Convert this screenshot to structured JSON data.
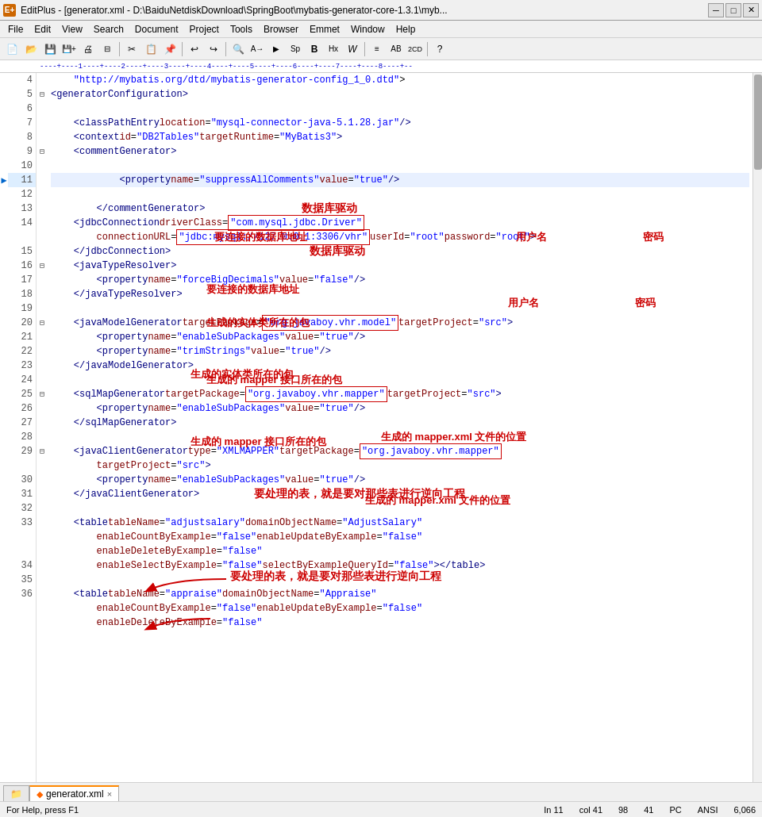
{
  "titlebar": {
    "title": "EditPlus - [generator.xml - D:\\BaiduNetdiskDownload\\SpringBoot\\mybatis-generator-core-1.3.1\\myb...",
    "app_name": "EditPlus"
  },
  "menu": {
    "items": [
      "File",
      "Edit",
      "View",
      "Search",
      "Document",
      "Project",
      "Tools",
      "Browser",
      "Emmet",
      "Window",
      "Help"
    ]
  },
  "ruler": {
    "content": "----+----1----+----2----+----3----+----4----+----5----+----6----+----7----+----8----+--"
  },
  "tab": {
    "icon": "◆",
    "name": "generator.xml",
    "close": "×"
  },
  "statusbar": {
    "help": "For Help, press F1",
    "ln": "In 11",
    "col": "col 41",
    "n1": "98",
    "n2": "41",
    "pc": "PC",
    "encoding": "ANSI",
    "lines": "6,066"
  },
  "annotations": {
    "db_driver": "数据库驱动",
    "db_url_label": "要连接的数据库地址",
    "username_label": "用户名",
    "password_label": "密码",
    "entity_package": "生成的实体类所在的包",
    "mapper_interface": "生成的 mapper 接口所在的包",
    "mapper_xml": "生成的 mapper.xml 文件的位置",
    "table_note": "要处理的表，就是要对那些表进行逆向工程"
  },
  "code_lines": [
    {
      "num": 4,
      "fold": "",
      "bp": "",
      "content": "    \"http://mybatis.org/dtd/mybatis-generator-config_1_0.dtd\">"
    },
    {
      "num": 5,
      "fold": "⊟",
      "bp": "",
      "content": "<generatorConfiguration>"
    },
    {
      "num": 6,
      "fold": "",
      "bp": "",
      "content": ""
    },
    {
      "num": 7,
      "fold": "",
      "bp": "",
      "content": "    <classPathEntry location=\"mysql-connector-java-5.1.28.jar\"/>"
    },
    {
      "num": 8,
      "fold": "",
      "bp": "",
      "content": "    <context id=\"DB2Tables\" targetRuntime=\"MyBatis3\">"
    },
    {
      "num": 9,
      "fold": "⊟",
      "bp": "",
      "content": "    <commentGenerator>"
    },
    {
      "num": 10,
      "fold": "",
      "bp": "",
      "content": ""
    },
    {
      "num": 11,
      "fold": "",
      "bp": "▶",
      "content": "            <property name=\"suppressAllComments\" value=\"true\" />"
    },
    {
      "num": 12,
      "fold": "",
      "bp": "",
      "content": ""
    },
    {
      "num": 13,
      "fold": "",
      "bp": "",
      "content": "        </commentGenerator>"
    },
    {
      "num": 14,
      "fold": "",
      "bp": "",
      "content": "    <jdbcConnection driverClass=\"com.mysql.jdbc.Driver\""
    },
    {
      "num": "14b",
      "fold": "",
      "bp": "",
      "content": "        connectionURL=\"jdbc:mysql://127.0.0.1:3306/vhr\" userId=\"root\" password=\"root\">"
    },
    {
      "num": 15,
      "fold": "",
      "bp": "",
      "content": "    </jdbcConnection>"
    },
    {
      "num": 16,
      "fold": "⊟",
      "bp": "",
      "content": "    <javaTypeResolver>"
    },
    {
      "num": 17,
      "fold": "",
      "bp": "",
      "content": "        <property name=\"forceBigDecimals\" value=\"false\"/>"
    },
    {
      "num": 18,
      "fold": "",
      "bp": "",
      "content": "    </javaTypeResolver>"
    },
    {
      "num": 19,
      "fold": "",
      "bp": "",
      "content": ""
    },
    {
      "num": 20,
      "fold": "⊟",
      "bp": "",
      "content": "    <javaModelGenerator targetPackage=\"org.javaboy.vhr.model\" targetProject=\"src\">"
    },
    {
      "num": 21,
      "fold": "",
      "bp": "",
      "content": "        <property name=\"enableSubPackages\" value=\"true\"/>"
    },
    {
      "num": 22,
      "fold": "",
      "bp": "",
      "content": "        <property name=\"trimStrings\" value=\"true\"/>"
    },
    {
      "num": 23,
      "fold": "",
      "bp": "",
      "content": "    </javaModelGenerator>"
    },
    {
      "num": 24,
      "fold": "",
      "bp": "",
      "content": ""
    },
    {
      "num": 25,
      "fold": "⊟",
      "bp": "",
      "content": "    <sqlMapGenerator targetPackage=\"org.javaboy.vhr.mapper\" targetProject=\"src\">"
    },
    {
      "num": 26,
      "fold": "",
      "bp": "",
      "content": "        <property name=\"enableSubPackages\" value=\"true\"/>"
    },
    {
      "num": 27,
      "fold": "",
      "bp": "",
      "content": "    </sqlMapGenerator>"
    },
    {
      "num": 28,
      "fold": "",
      "bp": "",
      "content": ""
    },
    {
      "num": 29,
      "fold": "⊟",
      "bp": "",
      "content": "    <javaClientGenerator type=\"XMLMAPPER\" targetPackage=\"org.javaboy.vhr.mapper\""
    },
    {
      "num": "29b",
      "fold": "",
      "bp": "",
      "content": "        targetProject=\"src\">"
    },
    {
      "num": 30,
      "fold": "",
      "bp": "",
      "content": "        <property name=\"enableSubPackages\" value=\"true\"/>"
    },
    {
      "num": 31,
      "fold": "",
      "bp": "",
      "content": "    </javaClientGenerator>"
    },
    {
      "num": 32,
      "fold": "",
      "bp": "",
      "content": ""
    },
    {
      "num": 33,
      "fold": "",
      "bp": "",
      "content": "    <table tableName=\"adjustsalary\" domainObjectName=\"AdjustSalary\""
    },
    {
      "num": "33b",
      "fold": "",
      "bp": "",
      "content": "        enableCountByExample=\"false\" enableUpdateByExample=\"false\""
    },
    {
      "num": "33c",
      "fold": "",
      "bp": "",
      "content": "        enableDeleteByExample=\"false\""
    },
    {
      "num": 34,
      "fold": "",
      "bp": "",
      "content": "        enableSelectByExample=\"false\" selectByExampleQueryId=\"false\"></table>"
    },
    {
      "num": 35,
      "fold": "",
      "bp": "",
      "content": ""
    },
    {
      "num": 36,
      "fold": "",
      "bp": "",
      "content": "    <table tableName=\"appraise\" domainObjectName=\"Appraise\""
    },
    {
      "num": "36b",
      "fold": "",
      "bp": "",
      "content": "        enableCountByExample=\"false\" enableUpdateByExample=\"false\""
    },
    {
      "num": "36c",
      "fold": "",
      "bp": "",
      "content": "        enableDeleteByExample=\"false\""
    }
  ]
}
